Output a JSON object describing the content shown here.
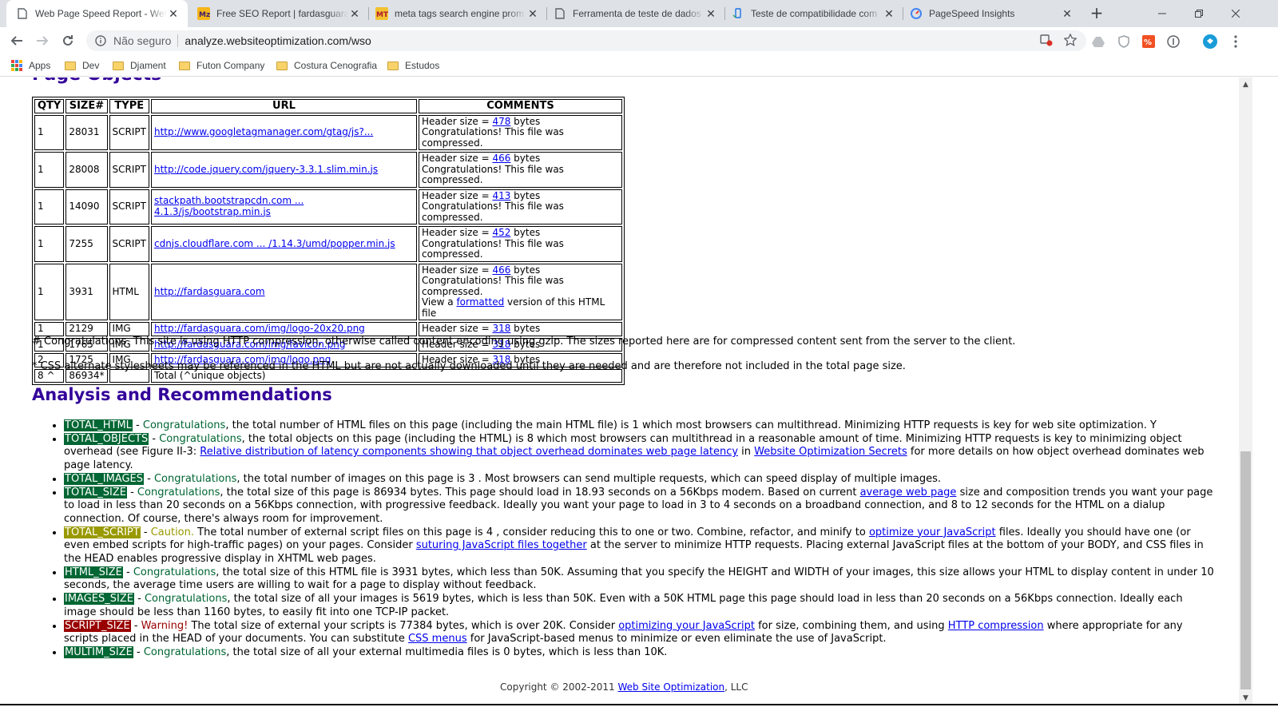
{
  "browser": {
    "tabs": [
      {
        "title": "Web Page Speed Report - Web",
        "icon": "page-icon",
        "active": true
      },
      {
        "title": "Free SEO Report | fardasguara.",
        "icon": "mz-icon"
      },
      {
        "title": "meta tags search engine prom",
        "icon": "mt-icon"
      },
      {
        "title": "Ferramenta de teste de dados",
        "icon": "page-icon"
      },
      {
        "title": "Teste de compatibilidade com",
        "icon": "mobile-test-icon"
      },
      {
        "title": "PageSpeed Insights",
        "icon": "pagespeed-icon"
      }
    ],
    "new_tab": "+",
    "omnibox": {
      "security": "Não seguro",
      "url": "analyze.websiteoptimization.com/wso"
    },
    "bookmarks": [
      {
        "label": "Apps",
        "icon": "apps-grid-icon"
      },
      {
        "label": "Dev",
        "icon": "folder-icon"
      },
      {
        "label": "Djament",
        "icon": "folder-icon"
      },
      {
        "label": "Futon Company",
        "icon": "folder-icon"
      },
      {
        "label": "Costura Cenografia",
        "icon": "folder-icon"
      },
      {
        "label": "Estudos",
        "icon": "folder-icon"
      }
    ]
  },
  "table": {
    "headers": [
      "QTY",
      "SIZE#",
      "TYPE",
      "URL",
      "COMMENTS"
    ],
    "rows": [
      {
        "qty": "1",
        "size": "28031",
        "type": "SCRIPT",
        "url": "http://www.googletagmanager.com/gtag/js?...",
        "header_size": "478",
        "compressed": true
      },
      {
        "qty": "1",
        "size": "28008",
        "type": "SCRIPT",
        "url": "http://code.jquery.com/jquery-3.3.1.slim.min.js",
        "header_size": "466",
        "compressed": true
      },
      {
        "qty": "1",
        "size": "14090",
        "type": "SCRIPT",
        "url": "stackpath.bootstrapcdn.com ... 4.1.3/js/bootstrap.min.js",
        "header_size": "413",
        "compressed": true
      },
      {
        "qty": "1",
        "size": "7255",
        "type": "SCRIPT",
        "url": "cdnjs.cloudflare.com ... /1.14.3/umd/popper.min.js",
        "header_size": "452",
        "compressed": true
      },
      {
        "qty": "1",
        "size": "3931",
        "type": "HTML",
        "url": "http://fardasguara.com",
        "header_size": "466",
        "compressed": true,
        "formatted": true
      },
      {
        "qty": "1",
        "size": "2129",
        "type": "IMG",
        "url": "http://fardasguara.com/img/logo-20x20.png",
        "header_size": "318"
      },
      {
        "qty": "1",
        "size": "1765",
        "type": "IMG",
        "url": "http://fardasguara.com/img/favicon.png",
        "header_size": "318"
      },
      {
        "qty": "2",
        "size": "1725",
        "type": "IMG",
        "url": "http://fardasguara.com/img/logo.png",
        "header_size": "318"
      }
    ],
    "comment_text": {
      "header_size_prefix": "Header size = ",
      "bytes_suffix": " bytes",
      "compressed": "Congratulations! This file was compressed.",
      "view_a": "View a ",
      "formatted_link": "formatted",
      "formatted_suffix": " version of this HTML file"
    },
    "total": {
      "qty": "8 ^",
      "size": "86934*",
      "label": "Total (^unique objects)"
    }
  },
  "notes": {
    "compression": "# Congratulations. This site is using HTTP compression, otherwise called content encoding using gzip. The sizes reported here are for compressed content sent from the server to the client.",
    "css": "* CSS alternate stylesheets may be referenced in the HTML but are not actually downloaded until they are needed and are therefore not included in the total page size."
  },
  "analysis": {
    "title": "Analysis and Recommendations",
    "items": [
      {
        "badge": "TOTAL_HTML",
        "status": "Congratulations",
        "level": "good",
        "parts": [
          {
            "t": ", the total number of HTML files on this page (including the main HTML file) is 1 which most browsers can multithread. Minimizing HTTP requests is key for web site optimization. Y"
          }
        ]
      },
      {
        "badge": "TOTAL_OBJECTS",
        "status": "Congratulations",
        "level": "good",
        "parts": [
          {
            "t": ", the total objects on this page (including the HTML) is 8 which most browsers can multithread in a reasonable amount of time. Minimizing HTTP requests is key to minimizing object overhead (see Figure II-3: "
          },
          {
            "link": "Relative distribution of latency components showing that object overhead dominates web page latency"
          },
          {
            "t": " in "
          },
          {
            "link": "Website Optimization Secrets"
          },
          {
            "t": " for more details on how object overhead dominates web page latency."
          }
        ]
      },
      {
        "badge": "TOTAL_IMAGES",
        "status": "Congratulations",
        "level": "good",
        "parts": [
          {
            "t": ", the total number of images on this page is 3 . Most browsers can send multiple requests, which can speed display of multiple images."
          }
        ]
      },
      {
        "badge": "TOTAL_SIZE",
        "status": "Congratulations",
        "level": "good",
        "parts": [
          {
            "t": ", the total size of this page is 86934 bytes. This page should load in 18.93 seconds on a 56Kbps modem. Based on current "
          },
          {
            "link": "average web page"
          },
          {
            "t": " size and composition trends you want your page to load in less than 20 seconds on a 56Kbps connection, with progressive feedback. Ideally you want your page to load in 3 to 4 seconds on a broadband connection, and 8 to 12 seconds for the HTML on a dialup connection. Of course, there's always room for improvement."
          }
        ]
      },
      {
        "badge": "TOTAL_SCRIPT",
        "status": "Caution.",
        "level": "warn",
        "parts": [
          {
            "t": " The total number of external script files on this page is 4 , consider reducing this to one or two. Combine, refactor, and minify to "
          },
          {
            "link": "optimize your JavaScript"
          },
          {
            "t": " files. Ideally you should have one (or even embed scripts for high-traffic pages) on your pages. Consider "
          },
          {
            "link": "suturing JavaScript files together"
          },
          {
            "t": " at the server to minimize HTTP requests. Placing external JavaScript files at the bottom of your BODY, and CSS files in the HEAD enables progressive display in XHTML web pages."
          }
        ]
      },
      {
        "badge": "HTML_SIZE",
        "status": "Congratulations",
        "level": "good",
        "parts": [
          {
            "t": ", the total size of this HTML file is 3931 bytes, which less than 50K. Assuming that you specify the HEIGHT and WIDTH of your images, this size allows your HTML to display content in under 10 seconds, the average time users are willing to wait for a page to display without feedback."
          }
        ]
      },
      {
        "badge": "IMAGES_SIZE",
        "status": "Congratulations",
        "level": "good",
        "parts": [
          {
            "t": ", the total size of all your images is 5619 bytes, which is less than 50K. Even with a 50K HTML page this page should load in less than 20 seconds on a 56Kbps connection. Ideally each image should be less than 1160 bytes, to easily fit into one TCP-IP packet."
          }
        ]
      },
      {
        "badge": "SCRIPT_SIZE",
        "status": "Warning!",
        "level": "bad",
        "parts": [
          {
            "t": " The total size of external your scripts is 77384 bytes, which is over 20K. Consider "
          },
          {
            "link": "optimizing your JavaScript"
          },
          {
            "t": " for size, combining them, and using "
          },
          {
            "link": "HTTP compression"
          },
          {
            "t": " where appropriate for any scripts placed in the HEAD of your documents. You can substitute "
          },
          {
            "link": "CSS menus"
          },
          {
            "t": " for JavaScript-based menus to minimize or even eliminate the use of JavaScript."
          }
        ]
      },
      {
        "badge": "MULTIM_SIZE",
        "status": "Congratulations",
        "level": "good",
        "parts": [
          {
            "t": ", the total size of all your external multimedia files is 0 bytes, which is less than 10K."
          }
        ]
      }
    ]
  },
  "footer": {
    "prefix": "Copyright © 2002-2011 ",
    "link": "Web Site Optimization",
    "suffix": ", LLC"
  },
  "colors": {
    "heading": "#330099",
    "good": "#006633",
    "warn": "#999900",
    "bad": "#990000",
    "link": "#0000ee"
  }
}
